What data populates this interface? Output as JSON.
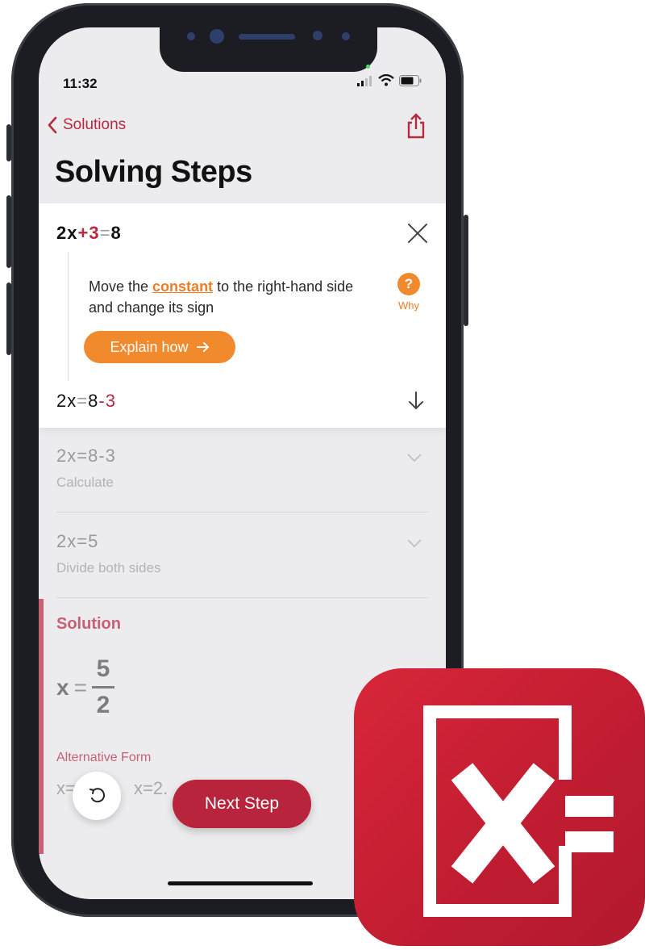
{
  "status_bar": {
    "time": "11:32"
  },
  "nav": {
    "back_label": "Solutions"
  },
  "page_title": "Solving Steps",
  "active_step": {
    "equation_before": {
      "a": "2x",
      "op": "+",
      "b": "3",
      "eq": "=",
      "c": "8"
    },
    "description_pre": "Move the ",
    "description_highlight": "constant",
    "description_post": " to the right-hand side and change its sign",
    "why_label": "Why",
    "explain_label": "Explain how",
    "equation_after": {
      "a": "2x",
      "eq": "=",
      "b": "8",
      "op": "-",
      "c": "3"
    }
  },
  "steps": [
    {
      "equation": "2x=8-3",
      "label": "Calculate"
    },
    {
      "equation": "2x=5",
      "label": "Divide both sides"
    }
  ],
  "solution": {
    "title": "Solution",
    "var": "x",
    "numerator": "5",
    "denominator": "2",
    "alt_label": "Alternative Form",
    "alt_text": "x=",
    "alt_text_2": "x=2.",
    "alt_denominator": "2"
  },
  "next_step_label": "Next Step",
  "colors": {
    "accent_red": "#b8283f",
    "accent_orange": "#f08a2d",
    "icon_red": "#d8263a"
  },
  "icons": [
    "chevron-left-icon",
    "share-icon",
    "close-icon",
    "help-icon",
    "arrow-right-icon",
    "arrow-down-icon",
    "chevron-down-icon",
    "undo-icon",
    "signal-icon",
    "wifi-icon",
    "battery-icon"
  ]
}
